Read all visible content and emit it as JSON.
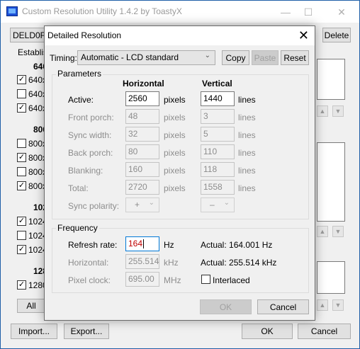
{
  "main_window": {
    "title": "Custom Resolution Utility 1.4.2 by ToastyX",
    "controls": {
      "minimize": "—",
      "maximize": "☐",
      "close": "✕"
    },
    "monitor_select": "DELD0F4",
    "delete_label": "Delete",
    "established_label": "Establis",
    "groups": [
      {
        "header": "640",
        "items": [
          {
            "label": "640x",
            "checked": true
          },
          {
            "label": "640x",
            "checked": false
          },
          {
            "label": "640x",
            "checked": true
          }
        ]
      },
      {
        "header": "800",
        "items": [
          {
            "label": "800x",
            "checked": false
          },
          {
            "label": "800x",
            "checked": true
          },
          {
            "label": "800x",
            "checked": false
          },
          {
            "label": "800x",
            "checked": true
          }
        ]
      },
      {
        "header": "102",
        "items": [
          {
            "label": "1024",
            "checked": true
          },
          {
            "label": "1024",
            "checked": false
          },
          {
            "label": "1024",
            "checked": true
          }
        ]
      },
      {
        "header": "128",
        "items": [
          {
            "label": "1280",
            "checked": true
          }
        ]
      }
    ],
    "all_button": "All",
    "import_button": "Import...",
    "export_button": "Export...",
    "ok_button": "OK",
    "cancel_button": "Cancel"
  },
  "dialog": {
    "title": "Detailed Resolution",
    "timing_label": "Timing:",
    "timing_value": "Automatic - LCD standard",
    "copy_button": "Copy",
    "paste_button": "Paste",
    "reset_button": "Reset",
    "parameters": {
      "group_label": "Parameters",
      "horizontal_header": "Horizontal",
      "vertical_header": "Vertical",
      "rows": [
        {
          "label": "Active:",
          "h_value": "2560",
          "h_unit": "pixels",
          "v_value": "1440",
          "v_unit": "lines",
          "enabled": true
        },
        {
          "label": "Front porch:",
          "h_value": "48",
          "h_unit": "pixels",
          "v_value": "3",
          "v_unit": "lines",
          "enabled": false
        },
        {
          "label": "Sync width:",
          "h_value": "32",
          "h_unit": "pixels",
          "v_value": "5",
          "v_unit": "lines",
          "enabled": false
        },
        {
          "label": "Back porch:",
          "h_value": "80",
          "h_unit": "pixels",
          "v_value": "110",
          "v_unit": "lines",
          "enabled": false
        },
        {
          "label": "Blanking:",
          "h_value": "160",
          "h_unit": "pixels",
          "v_value": "118",
          "v_unit": "lines",
          "enabled": false
        },
        {
          "label": "Total:",
          "h_value": "2720",
          "h_unit": "pixels",
          "v_value": "1558",
          "v_unit": "lines",
          "enabled": false
        }
      ],
      "sync_polarity_label": "Sync polarity:",
      "h_polarity": "+",
      "v_polarity": "–"
    },
    "frequency": {
      "group_label": "Frequency",
      "refresh_label": "Refresh rate:",
      "refresh_value": "164",
      "refresh_unit": "Hz",
      "actual_refresh": "Actual: 164.001 Hz",
      "horizontal_label": "Horizontal:",
      "horizontal_value": "255.514",
      "horizontal_unit": "kHz",
      "actual_horizontal": "Actual: 255.514 kHz",
      "pixel_clock_label": "Pixel clock:",
      "pixel_clock_value": "695.00",
      "pixel_clock_unit": "MHz",
      "interlaced_label": "Interlaced",
      "interlaced_checked": false
    },
    "ok_button": "OK",
    "cancel_button": "Cancel",
    "close_glyph": "✕"
  }
}
